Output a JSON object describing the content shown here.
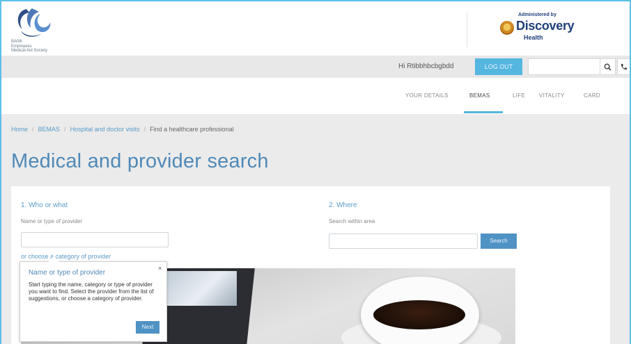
{
  "header": {
    "org_lines": [
      "BANK",
      "Employees",
      "Medical Aid Society"
    ],
    "administered_by": "Administered by",
    "admin_name": "Discovery",
    "admin_sub": "Health"
  },
  "userbar": {
    "greeting": "Hi Rtibbhbcbgbdd",
    "logout_label": "LOG OUT",
    "search_value": ""
  },
  "nav": {
    "items": [
      {
        "label": "YOUR DETAILS"
      },
      {
        "label": "BEMAS"
      },
      {
        "label": "LIFE"
      },
      {
        "label": "VITALITY"
      },
      {
        "label": "CARD"
      }
    ],
    "active": "BEMAS"
  },
  "breadcrumb": {
    "items": [
      "Home",
      "BEMAS",
      "Hospital and doctor visits"
    ],
    "current": "Find a healthcare professional"
  },
  "page": {
    "title": "Medical and provider search"
  },
  "search": {
    "who": {
      "title": "1. Who or what",
      "label": "Name or type of provider",
      "value": "",
      "category_link": "or choose a category of provider"
    },
    "where": {
      "title": "2. Where",
      "label": "Search within area",
      "value": "",
      "button": "Search"
    }
  },
  "tooltip": {
    "title": "Name or type of provider",
    "body": "Start typing the name, category or type of provider you want to find. Select the provider from the list of suggestions, or choose a category of provider.",
    "close": "×",
    "next": "Next"
  },
  "colors": {
    "accent": "#55b6e0",
    "link": "#5a9bc7",
    "title": "#4f89b8",
    "brand_navy": "#1f3f7a"
  }
}
